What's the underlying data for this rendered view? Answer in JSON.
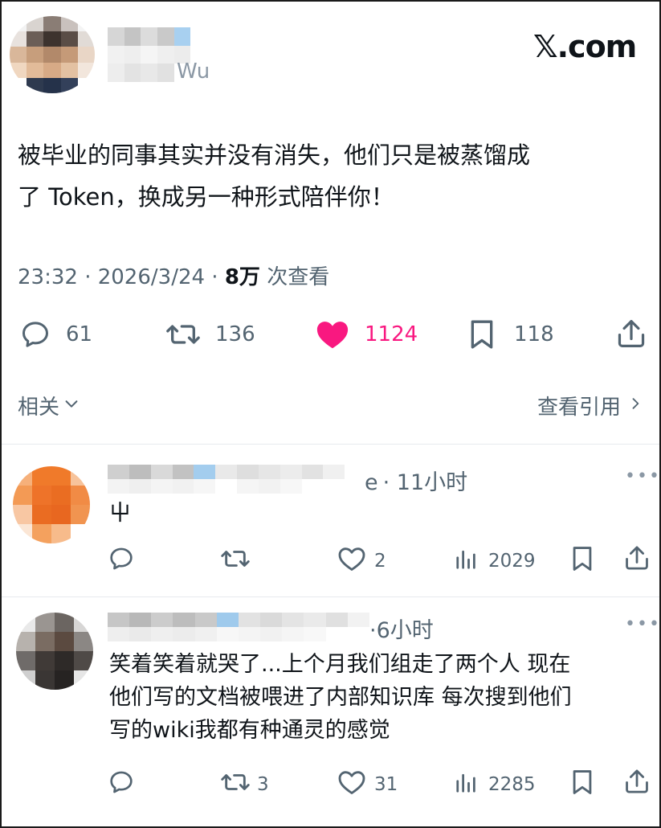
{
  "brand": "𝕏.com",
  "post": {
    "handle_tail": "Wu",
    "text_line1": "被毕业的同事其实并没有消失，他们只是被蒸馏成",
    "text_line2": "了 Token，换成另一种形式陪伴你！",
    "time": "23:32 · 2026/3/24 · ",
    "views_value": "8万",
    "views_label": " 次查看",
    "stats": {
      "replies": "61",
      "reposts": "136",
      "likes": "1124",
      "bookmarks": "118"
    },
    "related_label": "相关",
    "quotes_label": "查看引用"
  },
  "replies": [
    {
      "name_tail": "e",
      "time": "· 11小时",
      "text_lines": [
        "屮"
      ],
      "stats": {
        "likes": "2",
        "views": "2029"
      }
    },
    {
      "name_tail": "",
      "time": "·6小时",
      "text_lines": [
        "笑着笑着就哭了...上个月我们组走了两个人 现在",
        "他们写的文档被喂进了内部知识库 每次搜到他们",
        "写的wiki我都有种通灵的感觉"
      ],
      "stats": {
        "reposts": "3",
        "likes": "31",
        "views": "2285"
      }
    }
  ],
  "colors": {
    "text": "#0f1419",
    "muted": "#536471",
    "like": "#f91880",
    "divider": "#e7eaee"
  },
  "icons": [
    "comment-icon",
    "repost-icon",
    "heart-icon",
    "bookmark-icon",
    "share-icon",
    "views-icon",
    "chevron-down-icon",
    "chevron-right-icon",
    "more-icon"
  ]
}
